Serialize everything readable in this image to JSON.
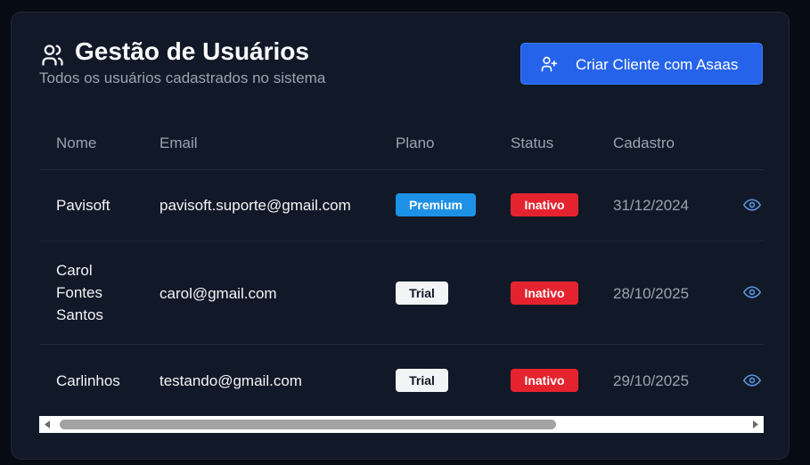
{
  "header": {
    "title": "Gestão de Usuários",
    "subtitle": "Todos os usuários cadastrados no sistema",
    "title_icon": "users-icon"
  },
  "actions": {
    "create_label": "Criar Cliente com Asaas",
    "create_icon": "user-plus-icon"
  },
  "table": {
    "columns": [
      "Nome",
      "Email",
      "Plano",
      "Status",
      "Cadastro"
    ],
    "rows": [
      {
        "name": "Pavisoft",
        "email": "pavisoft.suporte@gmail.com",
        "plan": "Premium",
        "status": "Inativo",
        "date": "31/12/2024",
        "action_icon": "eye-icon"
      },
      {
        "name": "Carol Fontes Santos",
        "email": "carol@gmail.com",
        "plan": "Trial",
        "status": "Inativo",
        "date": "28/10/2025",
        "action_icon": "eye-icon"
      },
      {
        "name": "Carlinhos",
        "email": "testando@gmail.com",
        "plan": "Trial",
        "status": "Inativo",
        "date": "29/10/2025",
        "action_icon": "eye-icon"
      }
    ]
  },
  "colors": {
    "background": "#070b14",
    "card": "#111827",
    "primary_button": "#2563eb",
    "premium_badge": "#1d91e6",
    "trial_badge": "#f3f4f6",
    "inactive_badge": "#e5232e",
    "eye_icon": "#5b8fd9"
  },
  "scrollbar": {
    "horizontal_position": 0,
    "visible_fraction": 0.69
  }
}
